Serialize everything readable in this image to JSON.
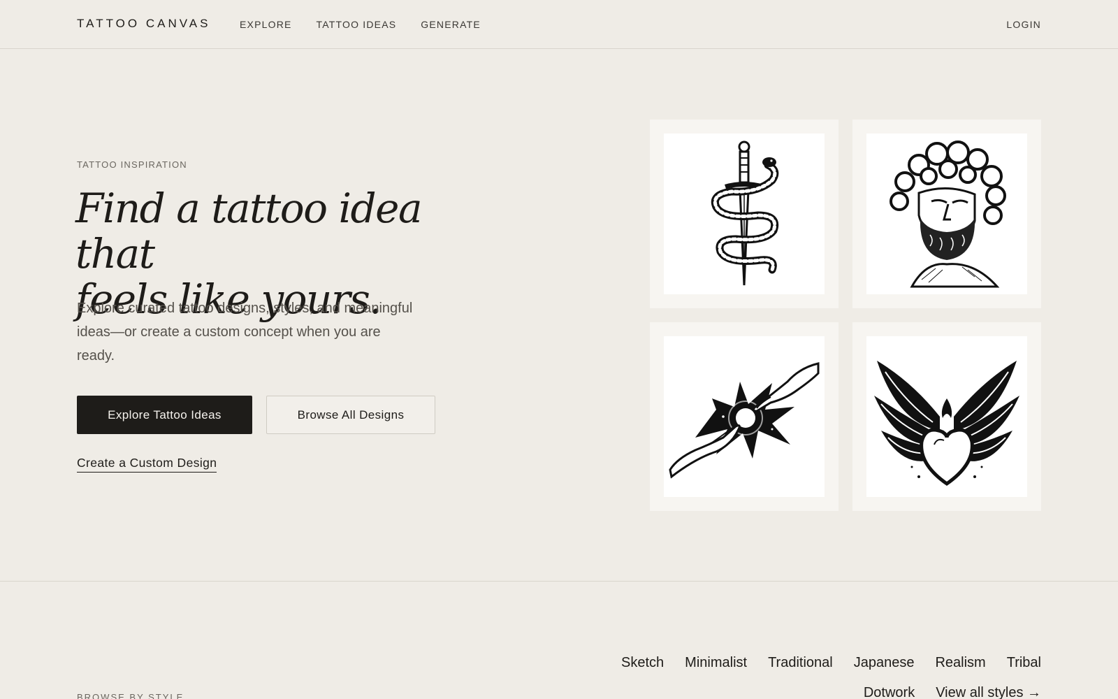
{
  "header": {
    "logo": "TATTOO CANVAS",
    "nav": [
      "EXPLORE",
      "TATTOO IDEAS",
      "GENERATE"
    ],
    "login": "LOGIN"
  },
  "hero": {
    "eyebrow": "TATTOO INSPIRATION",
    "headline_line1": "Find a tattoo idea that",
    "headline_line2": "feels like yours.",
    "lead": "Explore curated tattoo designs, styles, and meaningful ideas—or create a custom concept when you are ready.",
    "primary_button": "Explore Tattoo Ideas",
    "secondary_button": "Browse All Designs",
    "custom_link": "Create a Custom Design"
  },
  "gallery": {
    "tiles": [
      {
        "icon": "snake-dagger-icon"
      },
      {
        "icon": "greek-statue-head-icon"
      },
      {
        "icon": "reaching-hands-icon"
      },
      {
        "icon": "winged-heart-icon"
      }
    ]
  },
  "browse": {
    "label": "BROWSE BY STYLE",
    "styles_row1": [
      "Sketch",
      "Minimalist",
      "Traditional",
      "Japanese",
      "Realism",
      "Tribal"
    ],
    "styles_row2": [
      "Dotwork",
      "View all styles →"
    ]
  },
  "colors": {
    "background": "#efece6",
    "ink": "#1e1c19",
    "muted": "#6a665f",
    "divider": "#d9d5cd"
  }
}
